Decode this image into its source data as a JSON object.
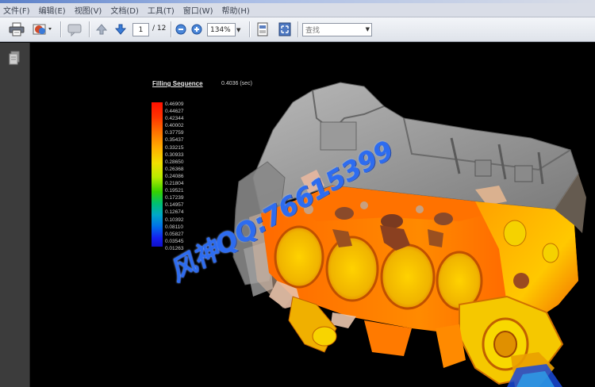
{
  "menu": {
    "items": [
      "文件(F)",
      "编辑(E)",
      "视图(V)",
      "文档(D)",
      "工具(T)",
      "窗口(W)",
      "帮助(H)"
    ]
  },
  "toolbar": {
    "current_page": "1",
    "total_pages": "/ 12",
    "zoom": "134%",
    "find_placeholder": "查找"
  },
  "document": {
    "title": "Filling Sequence",
    "value": "0.4036 (sec)",
    "legend": [
      "0.46909",
      "0.44627",
      "0.42344",
      "0.40002",
      "0.37759",
      "0.35437",
      "0.33215",
      "0.30933",
      "0.28650",
      "0.26368",
      "0.24086",
      "0.21804",
      "0.19521",
      "0.17239",
      "0.14957",
      "0.12674",
      "0.10392",
      "0.08110",
      "0.05827",
      "0.03545",
      "0.01263"
    ],
    "watermark": "风神QQ:76615399"
  },
  "colors": {
    "background": "#000000",
    "watermark": "#2d6cf0",
    "menubar": "#d9dde7"
  }
}
